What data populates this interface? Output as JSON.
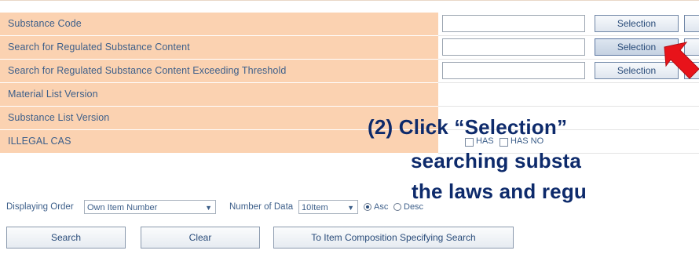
{
  "form": {
    "rows": [
      {
        "label": "Substance Code",
        "has_input": true,
        "button": "Selection"
      },
      {
        "label": "Search for Regulated Substance Content",
        "has_input": true,
        "button": "Selection"
      },
      {
        "label": "Search for Regulated Substance Content Exceeding Threshold",
        "has_input": true,
        "button": "Selection"
      },
      {
        "label": "Material List Version"
      },
      {
        "label": "Substance List Version"
      },
      {
        "label": "ILLEGAL CAS"
      }
    ],
    "illegal_cas_options": [
      "HAS",
      "HAS NO"
    ]
  },
  "options": {
    "displaying_order_label": "Displaying Order",
    "displaying_order_value": "Own Item Number",
    "number_of_data_label": "Number of Data",
    "number_of_data_value": "10Item",
    "sort_asc_label": "Asc",
    "sort_desc_label": "Desc"
  },
  "buttons": {
    "search": "Search",
    "clear": "Clear",
    "item_composition": "To Item Composition Specifying Search"
  },
  "annotation": {
    "line1": "(2)  Click “Selection”",
    "line2": "searching substa",
    "line3": "the laws and regu",
    "arrow_color": "#e8131a",
    "text_color": "#0d2a6b"
  },
  "colors": {
    "label_bg": "#fbd2b1",
    "label_text": "#3d5f8a"
  }
}
